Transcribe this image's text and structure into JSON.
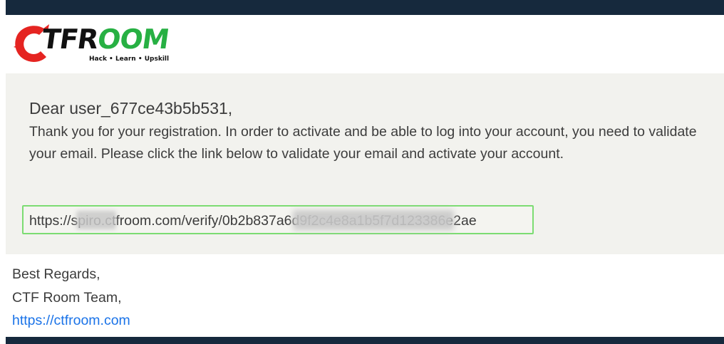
{
  "logo": {
    "wordmark_part1": "TFR",
    "wordmark_part2": "OOM",
    "tagline": "Hack • Learn • Upskill",
    "colors": {
      "c_mark": "#e52421",
      "green": "#27b043",
      "dark": "#111111"
    }
  },
  "email": {
    "greeting": "Dear user_677ce43b5b531,",
    "message": "Thank you for your registration. In order to activate and be able to log into your account, you need to validate your email. Please click the link below to validate your email and activate your account.",
    "verify_link": "https://spiro.ctfroom.com/verify/0b2b837a6d9f2c4e8a1b5f7d123386e2ae"
  },
  "signoff": {
    "regards": "Best Regards,",
    "team": "CTF Room Team,",
    "site_link": "https://ctfroom.com"
  },
  "colors": {
    "bar": "#16293d",
    "panel": "#f2f2ee",
    "link_border": "#7cdc72",
    "link": "#1a73e8"
  }
}
